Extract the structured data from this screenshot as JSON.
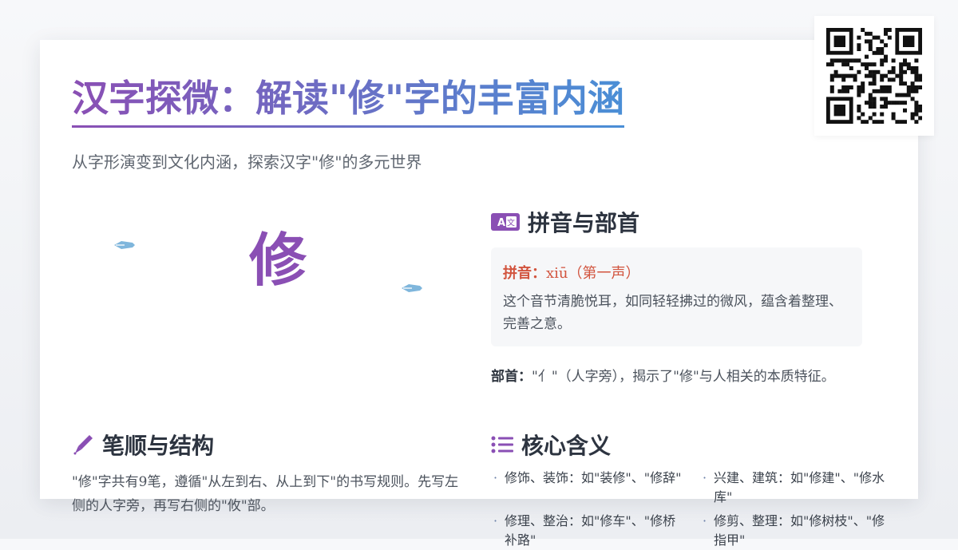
{
  "header": {
    "title": "汉字探微：解读\"修\"字的丰富内涵",
    "subtitle": "从字形演变到文化内涵，探索汉字\"修\"的多元世界"
  },
  "hero": {
    "character": "修",
    "left_icon": "pen-nib-icon",
    "right_icon": "pen-nib-icon"
  },
  "pinyin_section": {
    "icon": "language-icon",
    "heading": "拼音与部首",
    "pinyin_label": "拼音：",
    "pinyin_value": "xiū（第一声）",
    "pinyin_desc": "这个音节清脆悦耳，如同轻轻拂过的微风，蕴含着整理、完善之意。",
    "radical_label": "部首：",
    "radical_value": "\"亻\"（人字旁），揭示了\"修\"与人相关的本质特征。"
  },
  "stroke_section": {
    "icon": "pen-icon",
    "heading": "笔顺与结构",
    "text": "\"修\"字共有9笔，遵循\"从左到右、从上到下\"的书写规则。先写左侧的人字旁，再写右侧的\"攸\"部。"
  },
  "meaning_section": {
    "icon": "list-icon",
    "heading": "核心含义",
    "items": [
      "修饰、装饰：如\"装修\"、\"修辞\"",
      "兴建、建筑：如\"修建\"、\"修水库\"",
      "修理、整治：如\"修车\"、\"修桥补路\"",
      "修剪、整理：如\"修树枝\"、\"修指甲\""
    ]
  },
  "qr": {
    "icon": "qr-code-icon"
  },
  "colors": {
    "accent_purple": "#8a4fb4",
    "accent_blue": "#4a8fd6",
    "pinyin_red": "#d2543e",
    "brush_blue": "#7fb6dc"
  }
}
